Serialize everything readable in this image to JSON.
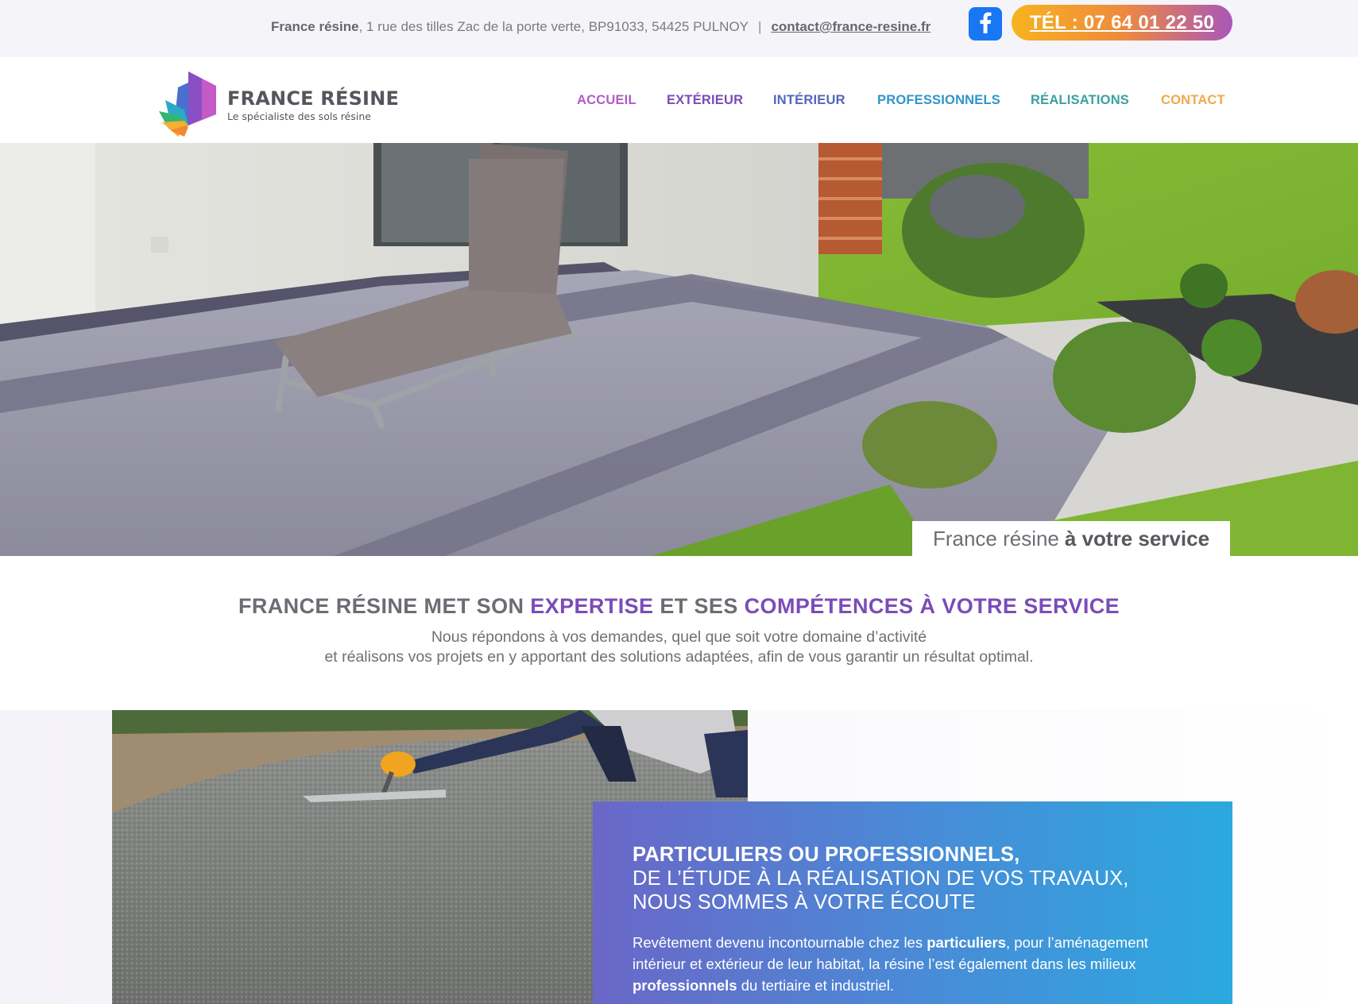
{
  "topbar": {
    "company": "France résine",
    "address": ", 1 rue des tilles Zac de la porte verte, BP91033, 54425 PULNOY",
    "separator": "|",
    "email": "contact@france-resine.fr",
    "facebook_icon": "facebook-icon",
    "phone_label": "TÉL : 07 64 01 22 50"
  },
  "logo": {
    "title": "FRANCE RÉSINE",
    "subtitle": "Le spécialiste des sols résine"
  },
  "nav": {
    "items": [
      {
        "label": "ACCUEIL",
        "color": "#b05cc6"
      },
      {
        "label": "EXTÉRIEUR",
        "color": "#7a4db5"
      },
      {
        "label": "INTÉRIEUR",
        "color": "#5466b8"
      },
      {
        "label": "PROFESSIONNELS",
        "color": "#3294c8"
      },
      {
        "label": "RÉALISATIONS",
        "color": "#3aa0a0"
      },
      {
        "label": "CONTACT",
        "color": "#f0a94a"
      }
    ]
  },
  "hero": {
    "tag_normal": "France résine",
    "tag_bold": "à votre service"
  },
  "expertise": {
    "title_part1": "FRANCE RÉSINE MET SON ",
    "title_hl1": "EXPERTISE",
    "title_part2": " ET SES ",
    "title_hl2": "COMPÉTENCES À VOTRE SERVICE",
    "line1": "Nous répondons à vos demandes, quel que soit votre domaine d’activité",
    "line2": "et réalisons vos projets en y apportant des solutions adaptées, afin de vous garantir un résultat optimal."
  },
  "info_box": {
    "heading_bold": "PARTICULIERS OU PROFESSIONNELS,",
    "heading_line2": "DE L’ÉTUDE À LA RÉALISATION DE VOS TRAVAUX,",
    "heading_line3": "NOUS SOMMES À VOTRE ÉCOUTE",
    "para_part1": "Revêtement devenu incontournable chez les ",
    "para_bold1": "particuliers",
    "para_part2": ", pour l’aménagement intérieur et extérieur de leur habitat, la résine l’est également dans les milieux ",
    "para_bold2": "professionnels",
    "para_part3": " du tertiaire et industriel."
  },
  "colors": {
    "accent_purple": "#7a4cb8",
    "facebook_blue": "#1877f2",
    "phone_gradient_start": "#f7b31e",
    "phone_gradient_end": "#a957b9",
    "box_gradient_start": "#6a67c7",
    "box_gradient_end": "#2ba9df"
  }
}
